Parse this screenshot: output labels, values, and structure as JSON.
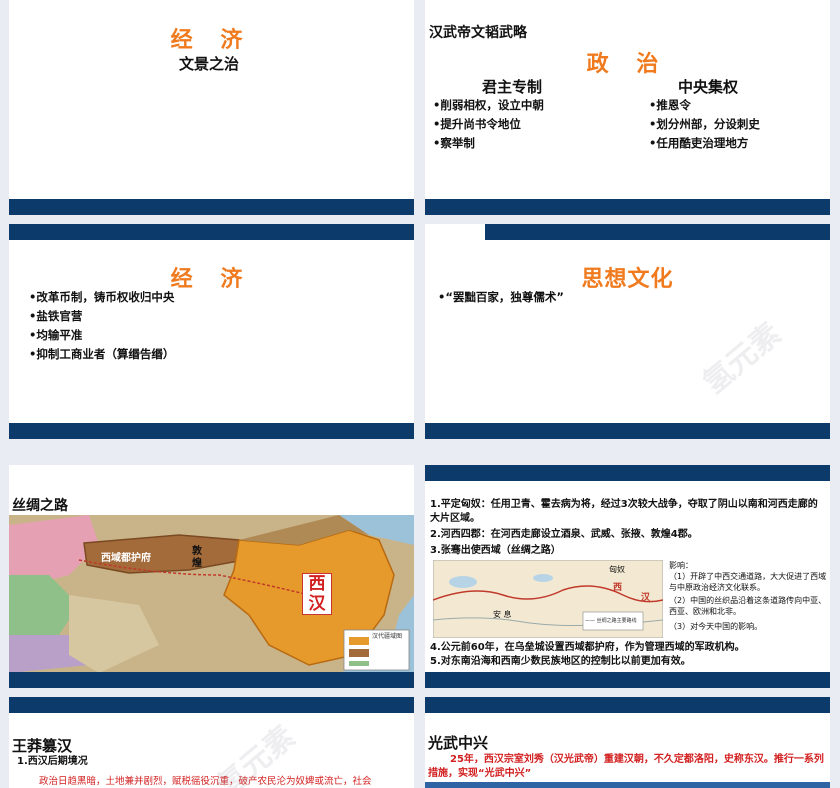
{
  "slide1": {
    "title": "经 济",
    "subtitle": "文景之治"
  },
  "slide2": {
    "heading": "汉武帝文韬武略",
    "title": "政 治",
    "col1_title": "君主专制",
    "col1_items": [
      "•削弱相权，设立中朝",
      "•提升尚书令地位",
      "•察举制"
    ],
    "col2_title": "中央集权",
    "col2_items": [
      "•推恩令",
      "•划分州部，分设刺史",
      "•任用酷吏治理地方"
    ]
  },
  "slide3": {
    "title": "经 济",
    "items": [
      "•改革币制，铸币权收归中央",
      "•盐铁官营",
      "•均输平准",
      "•抑制工商业者（算缗告缗）"
    ]
  },
  "slide4": {
    "title": "思想文化",
    "items": [
      "•“罢黜百家，独尊儒术”"
    ],
    "watermark": "氢元素"
  },
  "slide5": {
    "title": "丝绸之路",
    "map_labels": {
      "protectorate": "西域都护府",
      "dunhuang": "敦\n煌",
      "han": "西\n汉",
      "legend": "汉代疆域图"
    }
  },
  "slide6": {
    "points": [
      "1.平定匈奴：任用卫青、霍去病为将，经过3次较大战争，夺取了阴山以南和河西走廊的大片区域。",
      "2.河西四郡：在河西走廊设立酒泉、武威、张掖、敦煌4郡。",
      "3.张骞出使西域（丝绸之路）"
    ],
    "influence_title": "影响：",
    "influence_items": [
      "（1）开辟了中西交通道路，大大促进了西域与中原政治经济文化联系。",
      "（2）中国的丝织品沿着这条道路传向中亚、西亚、欧洲和北非。",
      "（3）对今天中国的影响。"
    ],
    "map_labels": {
      "xiongnu": "匈奴",
      "xi": "西",
      "han": "汉",
      "anxi": "安 息",
      "legend": "—— 丝绸之路主要路线"
    },
    "points_after": [
      "4.公元前60年，在乌垒城设置西域都护府，作为管理西域的军政机构。",
      "5.对东南沿海和西南少数民族地区的控制比以前更加有效。"
    ]
  },
  "slide7": {
    "title": "王莽篡汉",
    "sub": "1.西汉后期境况",
    "text": "政治日趋黑暗，土地兼并剧烈，赋税徭役沉重，破产农民沦为奴婢或流亡，社会",
    "watermark": "氢元素"
  },
  "slide8": {
    "title": "光武中兴",
    "text": "25年，西汉宗室刘秀（汉光武帝）重建汉朝，不久定都洛阳，史称东汉。推行一系列措施，实现“光武中兴”"
  }
}
